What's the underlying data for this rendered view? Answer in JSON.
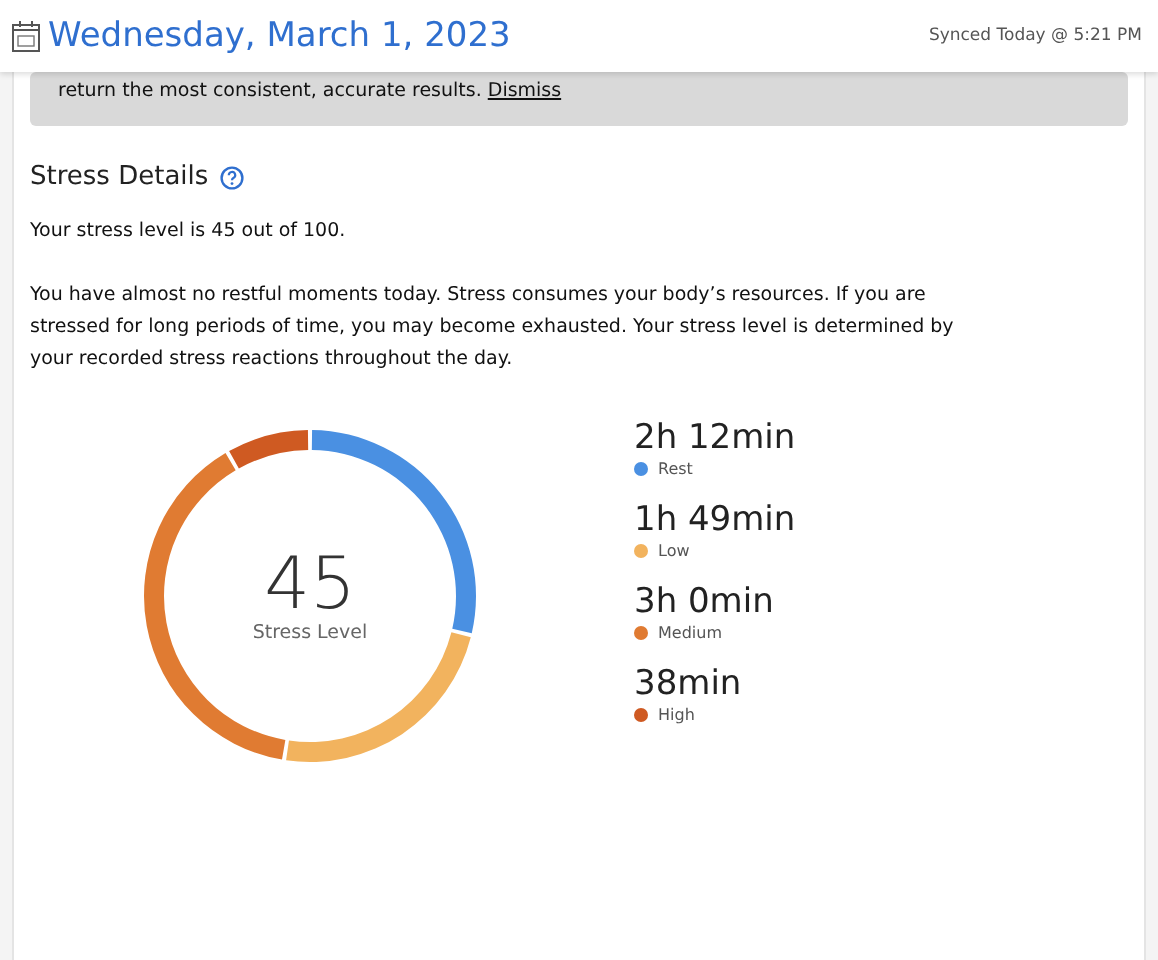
{
  "header": {
    "date": "Wednesday, March 1, 2023",
    "sync": "Synced Today @ 5:21 PM"
  },
  "banner": {
    "text": "return the most consistent, accurate results.",
    "link": "Dismiss"
  },
  "stress": {
    "title": "Stress Details",
    "summary": "Your stress level is 45 out of 100.",
    "description": "You have almost no restful moments today. Stress consumes your body’s resources. If you are stressed for long periods of time, you may become exhausted. Your stress level is determined by your recorded stress reactions throughout the day.",
    "score": "45",
    "score_label": "Stress Level",
    "chart_data": {
      "type": "donut",
      "categories": [
        "Rest",
        "Low",
        "Medium",
        "High"
      ],
      "values": [
        28.8,
        23.7,
        39.2,
        8.3
      ]
    },
    "legend": [
      {
        "duration": "2h 12min",
        "color": "#4a90e2"
      },
      {
        "duration": "1h 49min",
        "color": "#f2b35e"
      },
      {
        "duration": "3h 0min",
        "color": "#e07b32"
      },
      {
        "duration": "38min",
        "color": "#cf5a22"
      }
    ]
  }
}
